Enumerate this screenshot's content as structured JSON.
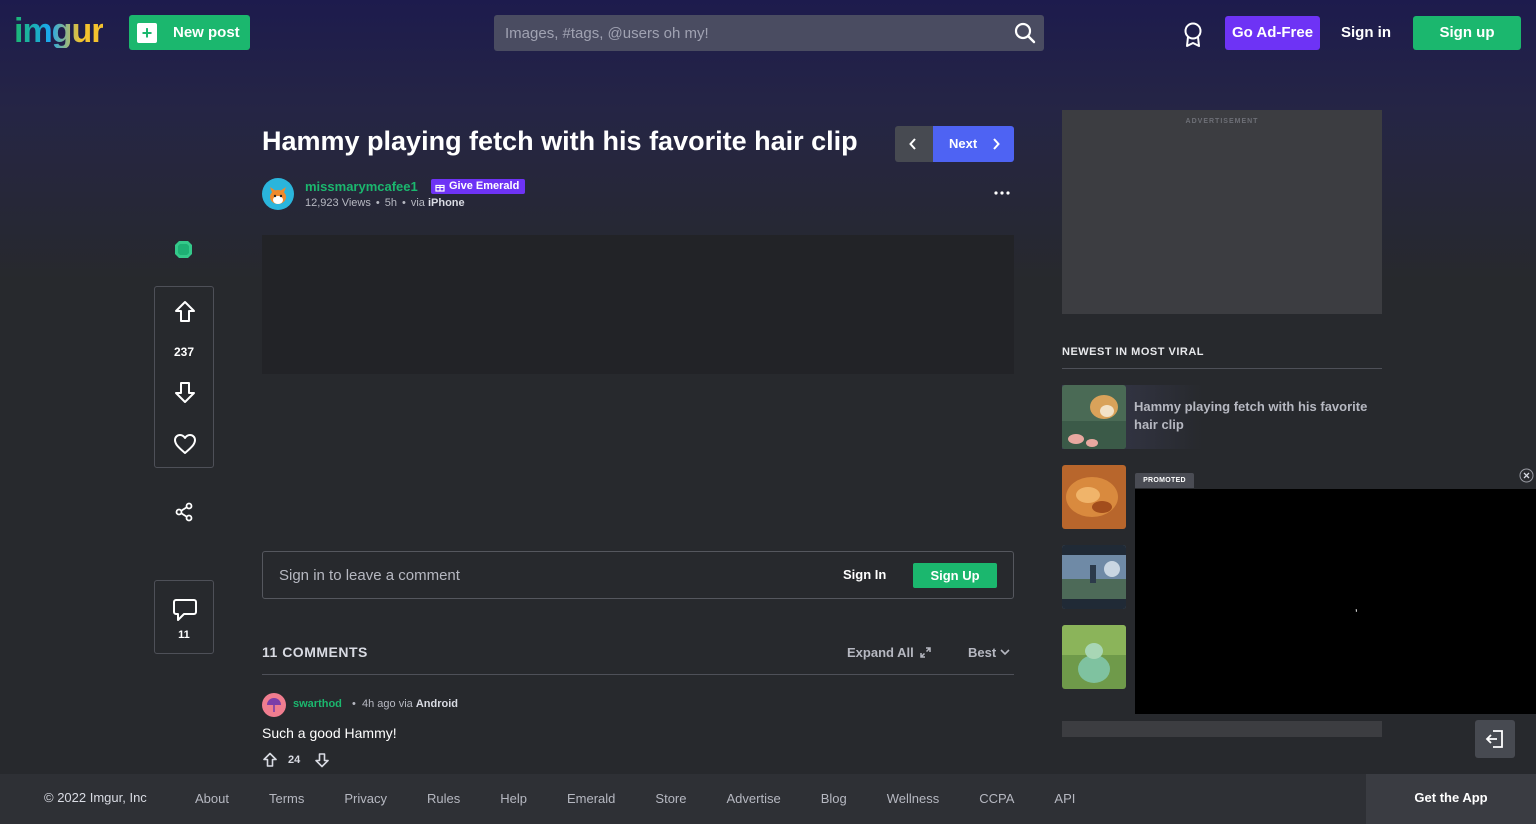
{
  "header": {
    "logo": "imgur",
    "new_post_label": "New post",
    "search_placeholder": "Images, #tags, @users oh my!",
    "go_ad_free_label": "Go Ad-Free",
    "sign_in_label": "Sign in",
    "sign_up_label": "Sign up"
  },
  "post": {
    "title": "Hammy playing fetch with his favorite hair clip",
    "next_label": "Next",
    "author": "missmarymcafee1",
    "give_emerald_label": "Give Emerald",
    "views": "12,923 Views",
    "age": "5h",
    "via_label": "via",
    "platform": "iPhone",
    "score": "237",
    "comment_count": "11"
  },
  "comment_box": {
    "placeholder": "Sign in to leave a comment",
    "sign_in_label": "Sign In",
    "sign_up_label": "Sign Up"
  },
  "comments": {
    "header": "11 COMMENTS",
    "expand_label": "Expand All",
    "sort_label": "Best",
    "items": [
      {
        "user": "swarthod",
        "age": "4h ago",
        "via_label": "via",
        "platform": "Android",
        "text": "Such a good Hammy!",
        "score": "24"
      }
    ]
  },
  "sidebar": {
    "ad_label": "ADVERTISEMENT",
    "viral_heading": "NEWEST IN MOST VIRAL",
    "viral_items": [
      {
        "title": "Hammy playing fetch with his favorite hair clip"
      }
    ],
    "promoted_label": "PROMOTED"
  },
  "footer": {
    "copyright": "© 2022 Imgur, Inc",
    "links": [
      "About",
      "Terms",
      "Privacy",
      "Rules",
      "Help",
      "Emerald",
      "Store",
      "Advertise",
      "Blog",
      "Wellness",
      "CCPA",
      "API"
    ],
    "get_app_label": "Get the App"
  },
  "colors": {
    "brand_green": "#1bb76e",
    "emerald_purple": "#6e33f5",
    "next_blue": "#4e63f3"
  }
}
